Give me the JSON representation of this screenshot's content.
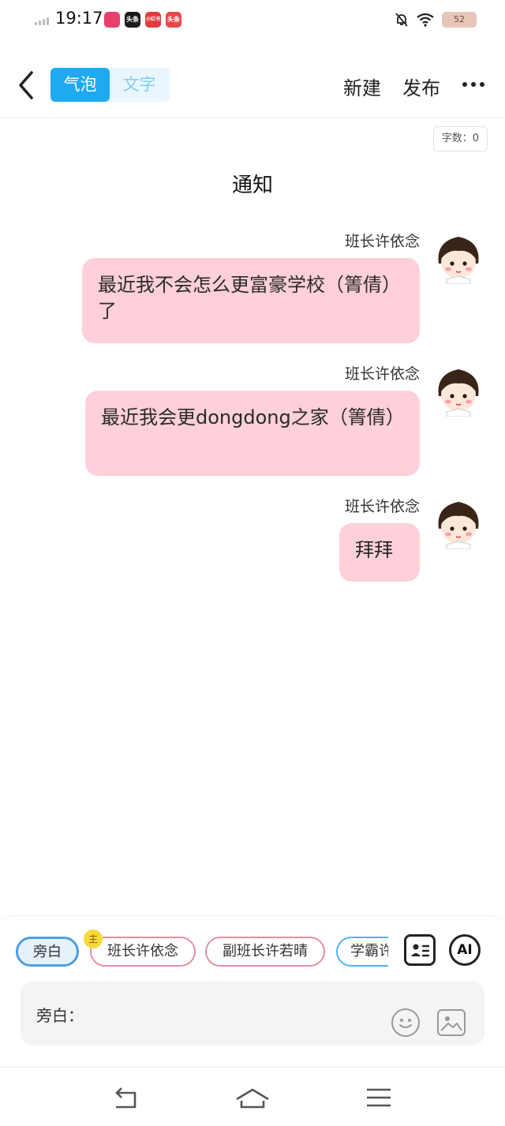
{
  "status_bar": {
    "time": "19:17",
    "app_icons": [
      {
        "label": "",
        "color": "#e83e6b",
        "name": "app-icon-1"
      },
      {
        "label": "头条",
        "color": "#1b1b1b",
        "name": "app-icon-2"
      },
      {
        "label": "小红书",
        "color": "#e23b3b",
        "name": "app-icon-3"
      },
      {
        "label": "头条",
        "color": "#e64848",
        "name": "app-icon-4"
      }
    ],
    "battery": "52"
  },
  "header": {
    "mode_tabs": [
      "气泡",
      "文字"
    ],
    "new_label": "新建",
    "publish_label": "发布"
  },
  "word_count": "字数：0",
  "title": "通知",
  "messages": [
    {
      "name": "班长许依念",
      "text": "最近我不会怎么更富豪学校（箐倩）了"
    },
    {
      "name": "班长许依念",
      "text": "最近我会更dongdong之家（箐倩）"
    },
    {
      "name": "班长许依念",
      "text": "拜拜"
    }
  ],
  "composer": {
    "roles": [
      "旁白",
      "班长许依念",
      "副班长许若晴",
      "学霸许"
    ],
    "role_badge": "主",
    "ai_label": "AI",
    "input_label": "旁白："
  },
  "colors": {
    "accent": "#1eaaf0",
    "bubble": "#fdd0da"
  }
}
